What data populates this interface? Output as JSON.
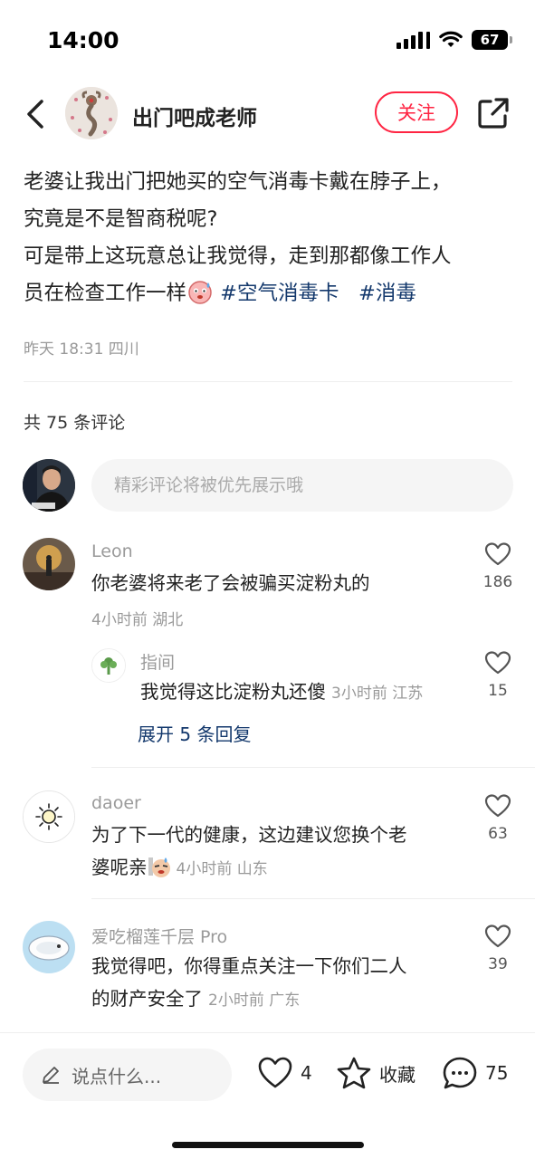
{
  "status_bar": {
    "time": "14:00",
    "battery": "67"
  },
  "header": {
    "author_name": "出门吧成老师",
    "follow_label": "关注"
  },
  "post": {
    "line1": "老婆让我出门把她买的空气消毒卡戴在脖子上，",
    "line2": "究竟是不是智商税呢?",
    "line3": "可是带上这玩意总让我觉得，走到那都像工作人",
    "line4": "员在检查工作一样",
    "hashtags": [
      "#空气消毒卡",
      "#消毒"
    ],
    "meta": "昨天 18:31 四川"
  },
  "comments_header": "共 75 条评论",
  "comment_input_placeholder": "精彩评论将被优先展示哦",
  "comments": [
    {
      "name": "Leon",
      "text": "你老婆将来老了会被骗买淀粉丸的",
      "meta": "4小时前 湖北",
      "likes": "186"
    },
    {
      "name": "指间",
      "text": "我觉得这比淀粉丸还傻",
      "meta": "3小时前 江苏",
      "likes": "15"
    },
    {
      "name": "daoer",
      "text_line1": "为了下一代的健康，这边建议您换个老",
      "text_line2": "婆呢亲",
      "meta": "4小时前 山东",
      "likes": "63"
    },
    {
      "name": "爱吃榴莲千层 Pro",
      "text_line1": "我觉得吧，你得重点关注一下你们二人",
      "text_line2": "的财产安全了",
      "meta": "2小时前 广东",
      "likes": "39"
    }
  ],
  "expand_replies": "展开 5 条回复",
  "bottom_bar": {
    "input_placeholder": "说点什么...",
    "like_count": "4",
    "collect_label": "收藏",
    "comment_count": "75"
  },
  "colors": {
    "accent_red": "#ff2442",
    "hashtag_blue": "#13386c",
    "meta_gray": "#9a9a9a"
  }
}
